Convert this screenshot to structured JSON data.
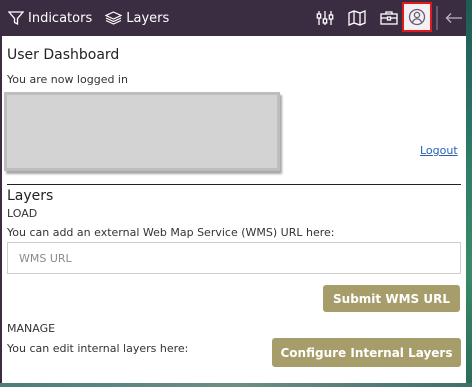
{
  "topbar": {
    "tabs": [
      {
        "label": "Indicators",
        "icon": "filter-icon"
      },
      {
        "label": "Layers",
        "icon": "layers-icon"
      }
    ],
    "icons": [
      "sliders-icon",
      "map-icon",
      "toolbox-icon",
      "user-icon"
    ],
    "active_icon": "user-icon",
    "collapse_icon": "arrow-left-icon"
  },
  "dashboard": {
    "title": "User Dashboard",
    "status": "You are now logged in",
    "logout_label": "Logout"
  },
  "layers": {
    "title": "Layers",
    "load_label": "LOAD",
    "load_desc": "You can add an external Web Map Service (WMS) URL here:",
    "wms_placeholder": "WMS URL",
    "submit_label": "Submit WMS URL",
    "manage_label": "MANAGE",
    "manage_desc": "You can edit internal layers here:",
    "configure_label": "Configure Internal Layers"
  },
  "colors": {
    "topbar": "#3b2d41",
    "button": "#a79d6a",
    "active_border": "#e0191f",
    "link": "#2a5fb5"
  }
}
